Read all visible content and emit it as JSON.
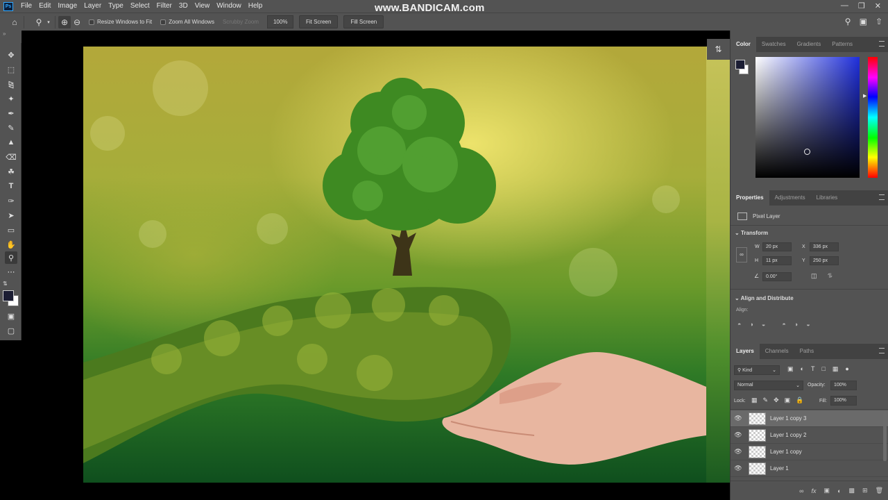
{
  "app": {
    "logo": "Ps"
  },
  "menu": [
    "File",
    "Edit",
    "Image",
    "Layer",
    "Type",
    "Select",
    "Filter",
    "3D",
    "View",
    "Window",
    "Help"
  ],
  "watermark": "www.BANDICAM.com",
  "options": {
    "resize_windows": "Resize Windows to Fit",
    "zoom_all": "Zoom All Windows",
    "scrubby_zoom": "Scrubby Zoom",
    "zoom_value": "100%",
    "fit_screen": "Fit Screen",
    "fill_screen": "Fill Screen"
  },
  "color_panel": {
    "tabs": [
      "Color",
      "Swatches",
      "Gradients",
      "Patterns"
    ],
    "active_tab": "Color",
    "foreground": "#1b1d33",
    "background": "#ffffff",
    "picker_hue": "#1f2fdc"
  },
  "properties_panel": {
    "tabs": [
      "Properties",
      "Adjustments",
      "Libraries"
    ],
    "layer_type": "Pixel Layer",
    "transform_title": "Transform",
    "w_label": "W",
    "w_value": "20 px",
    "h_label": "H",
    "h_value": "11 px",
    "x_label": "X",
    "x_value": "336 px",
    "y_label": "Y",
    "y_value": "250 px",
    "angle_value": "0.00°",
    "align_title": "Align and Distribute",
    "align_label": "Align:"
  },
  "layers_panel": {
    "tabs": [
      "Layers",
      "Channels",
      "Paths"
    ],
    "filter_kind": "Kind",
    "blend_mode": "Normal",
    "opacity_label": "Opacity:",
    "opacity_value": "100%",
    "lock_label": "Lock:",
    "fill_label": "Fill:",
    "fill_value": "100%",
    "layers": [
      {
        "name": "Layer 1 copy 3",
        "selected": true
      },
      {
        "name": "Layer 1 copy 2",
        "selected": false
      },
      {
        "name": "Layer 1 copy",
        "selected": false
      },
      {
        "name": "Layer 1",
        "selected": false
      }
    ]
  }
}
